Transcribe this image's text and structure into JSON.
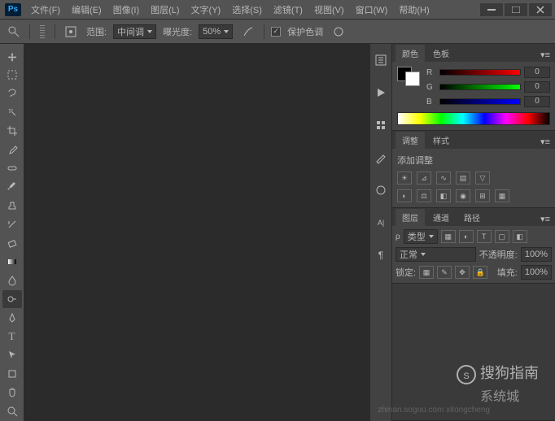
{
  "menubar": [
    "文件(F)",
    "编辑(E)",
    "图像(I)",
    "图层(L)",
    "文字(Y)",
    "选择(S)",
    "滤镜(T)",
    "视图(V)",
    "窗口(W)",
    "帮助(H)"
  ],
  "options": {
    "range_label": "范围:",
    "range_value": "中间调",
    "exposure_label": "曝光度:",
    "exposure_value": "50%",
    "protect_label": "保护色调"
  },
  "panels": {
    "color": {
      "tab1": "颜色",
      "tab2": "色板",
      "r": "R",
      "g": "G",
      "b": "B",
      "rv": "0",
      "gv": "0",
      "bv": "0"
    },
    "adjust": {
      "tab1": "调整",
      "tab2": "样式",
      "add": "添加调整"
    },
    "layers": {
      "tab1": "图层",
      "tab2": "通道",
      "tab3": "路径",
      "kind": "类型",
      "blend": "正常",
      "opacity_label": "不透明度:",
      "opacity_value": "100%",
      "lock_label": "锁定:",
      "fill_label": "填充:",
      "fill_value": "100%"
    }
  },
  "watermarks": {
    "w1": "搜狗指南",
    "w2": "系统城",
    "url": "zhinan.sogou.com xitongcheng"
  }
}
